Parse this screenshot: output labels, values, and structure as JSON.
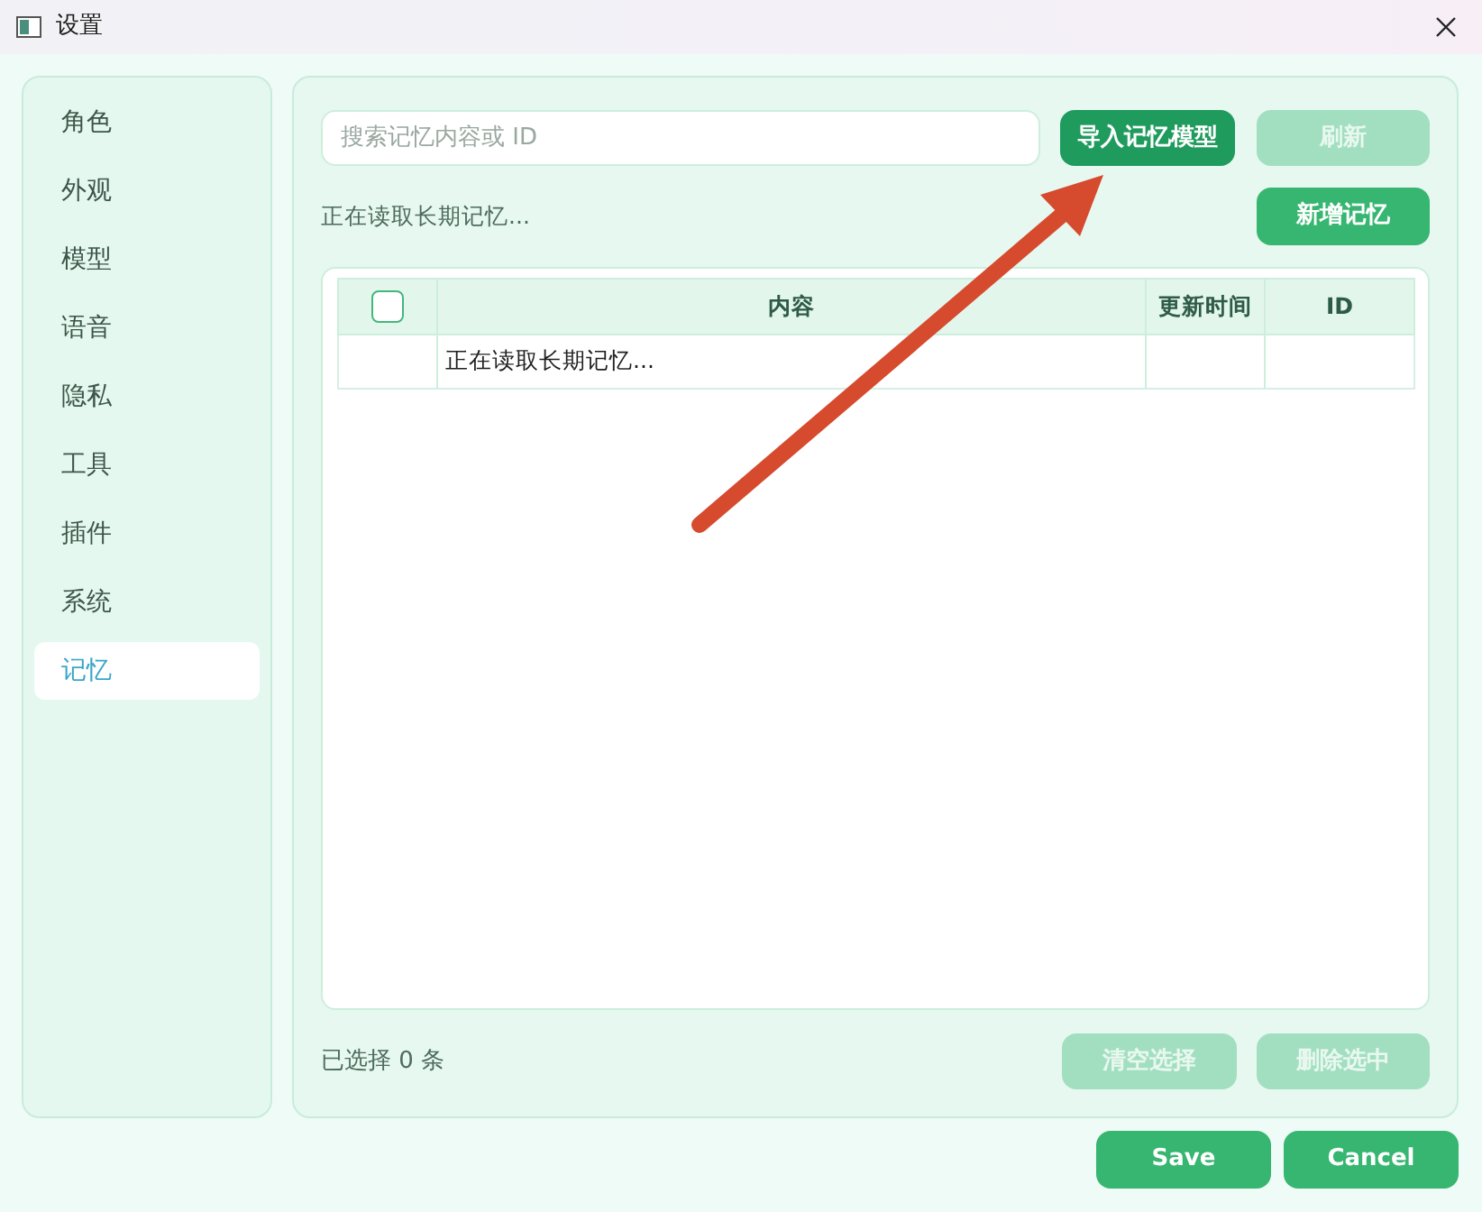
{
  "window": {
    "title": "设置"
  },
  "sidebar": {
    "items": [
      {
        "label": "角色",
        "selected": false
      },
      {
        "label": "外观",
        "selected": false
      },
      {
        "label": "模型",
        "selected": false
      },
      {
        "label": "语音",
        "selected": false
      },
      {
        "label": "隐私",
        "selected": false
      },
      {
        "label": "工具",
        "selected": false
      },
      {
        "label": "插件",
        "selected": false
      },
      {
        "label": "系统",
        "selected": false
      },
      {
        "label": "记忆",
        "selected": true
      }
    ]
  },
  "toolbar": {
    "search": {
      "placeholder": "搜索记忆内容或 ID"
    },
    "buttons": [
      {
        "label": "导入记忆模型",
        "disabled": false,
        "focused": true
      },
      {
        "label": "刷新",
        "disabled": true,
        "focused": false
      }
    ]
  },
  "status": "正在读取长期记忆...",
  "add_button": {
    "label": "新增记忆",
    "disabled": false
  },
  "table": {
    "select_all": {
      "checked": false
    },
    "columns": [
      "内容",
      "更新时间",
      "ID"
    ],
    "rows": [
      {
        "content": "正在读取长期记忆..."
      }
    ]
  },
  "footer": {
    "selection_count": "已选择 0 条",
    "buttons": [
      {
        "label": "清空选择",
        "disabled": true
      },
      {
        "label": "删除选中",
        "disabled": true
      }
    ]
  },
  "dialog_buttons": [
    "Save",
    "Cancel"
  ]
}
